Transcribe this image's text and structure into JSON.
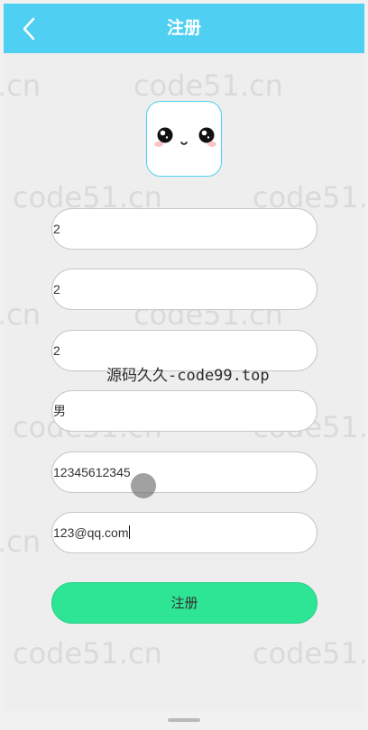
{
  "header": {
    "title": "注册",
    "back_icon": "chevron-left-icon"
  },
  "avatar": {
    "icon": "cute-face-icon"
  },
  "form": {
    "fields": [
      {
        "name": "username",
        "value": "2"
      },
      {
        "name": "password",
        "value": "2"
      },
      {
        "name": "confirm-password",
        "value": "2"
      },
      {
        "name": "gender",
        "value": "男"
      },
      {
        "name": "phone",
        "value": "12345612345"
      },
      {
        "name": "email",
        "value": "123@qq.com"
      }
    ],
    "submit_label": "注册"
  },
  "watermarks": {
    "repeat_text": "code51.cn",
    "left_partial": ".cn",
    "center_text": "源码久久-code99.top"
  },
  "colors": {
    "header": "#4fd0f2",
    "submit": "#2ee596",
    "page_bg": "#eeeeee"
  }
}
